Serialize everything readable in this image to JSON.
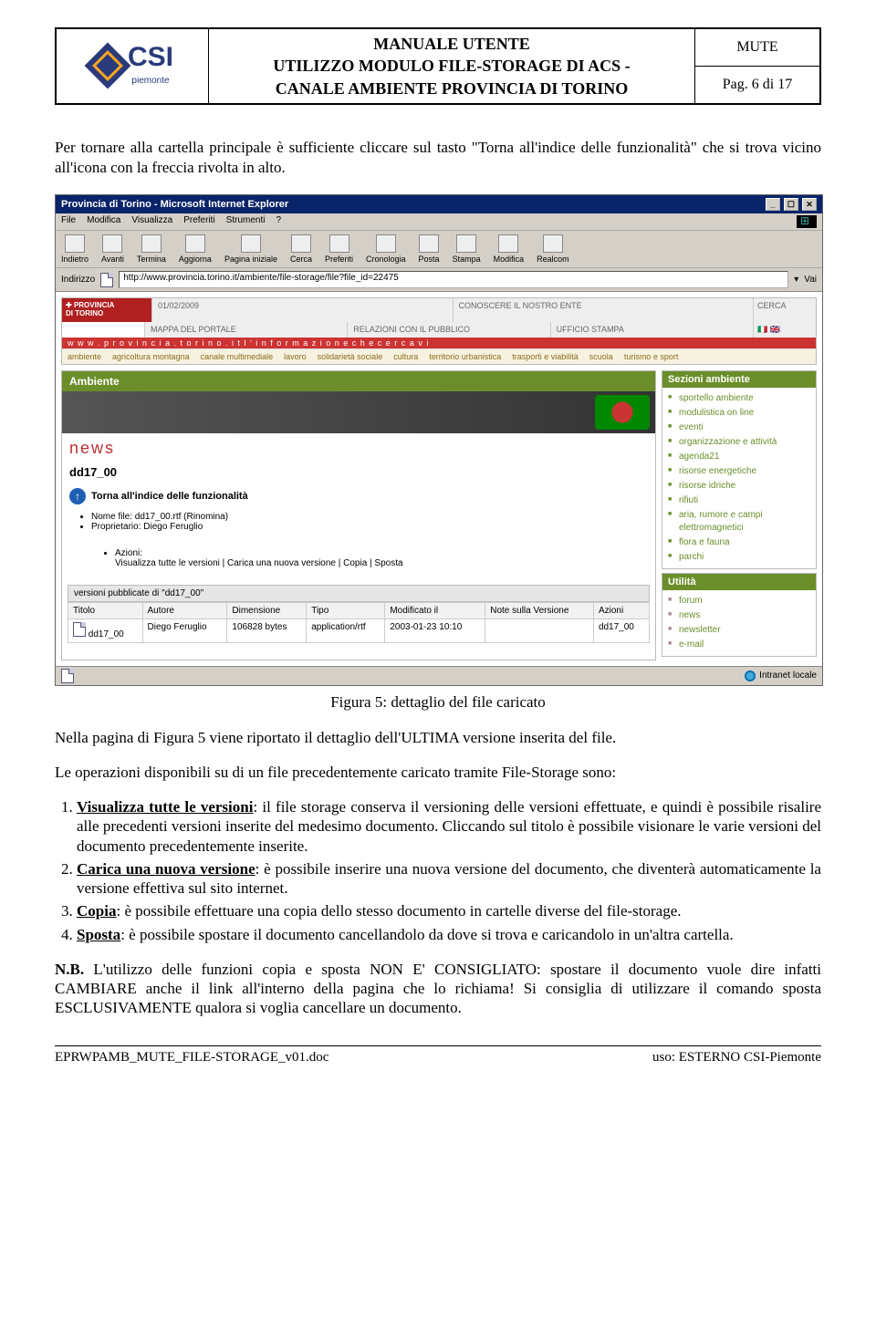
{
  "header": {
    "logo_main": "CSI",
    "logo_sub": "piemonte",
    "title_l1": "MANUALE UTENTE",
    "title_l2": "UTILIZZO MODULO FILE-STORAGE DI ACS -",
    "title_l3": "CANALE AMBIENTE PROVINCIA DI TORINO",
    "right_top": "MUTE",
    "right_bottom": "Pag. 6 di 17"
  },
  "intro": "Per tornare alla cartella principale è sufficiente cliccare sul tasto \"Torna all'indice delle funzionalità\" che si trova vicino all'icona con la freccia rivolta in alto.",
  "screenshot": {
    "title": "Provincia di Torino - Microsoft Internet Explorer",
    "menu": [
      "File",
      "Modifica",
      "Visualizza",
      "Preferiti",
      "Strumenti",
      "?"
    ],
    "toolbar": [
      "Indietro",
      "Avanti",
      "Termina",
      "Aggiorna",
      "Pagina iniziale",
      "Cerca",
      "Preferiti",
      "Cronologia",
      "Posta",
      "Stampa",
      "Modifica",
      "Realcom"
    ],
    "address_label": "Indirizzo",
    "address_url": "http://www.provincia.torino.it/ambiente/file-storage/file?file_id=22475",
    "go_label": "Vai",
    "portal": {
      "logo_l1": "PROVINCIA",
      "logo_l2": "DI TORINO",
      "date": "01/02/2009",
      "top_links1": [
        "CONOSCERE IL NOSTRO ENTE",
        "CERCA"
      ],
      "top_links2": [
        "MAPPA DEL PORTALE",
        "RELAZIONI CON IL PUBBLICO",
        "UFFICIO STAMPA"
      ],
      "tagline": "w w w . p r o v i n c i a . t o r i n o . i t   l ' i n f o r m a z i o n e   c h e   c e r c a v i",
      "nav_links": [
        "ambiente",
        "agricoltura montagna",
        "canale multimediale",
        "lavoro",
        "solidarietà sociale",
        "cultura",
        "territorio urbanistica",
        "trasporti e viabilità",
        "scuola",
        "turismo e sport"
      ],
      "main_title": "Ambiente",
      "news_label": "news",
      "file_code": "dd17_00",
      "torna_label": "Torna all'indice delle funzionalità",
      "meta_name": "Nome file: dd17_00.rtf (Rinomina)",
      "meta_owner": "Proprietario: Diego Feruglio",
      "actions_label": "Azioni:",
      "actions": "Visualizza tutte le versioni | Carica una nuova versione | Copia | Sposta",
      "versions_header": "versioni pubblicate di \"dd17_00\"",
      "table_headers": [
        "Titolo",
        "Autore",
        "Dimensione",
        "Tipo",
        "Modificato il",
        "Note sulla Versione",
        "Azioni"
      ],
      "table_row": {
        "title": "dd17_00",
        "author": "Diego Feruglio",
        "size": "106828 bytes",
        "type": "application/rtf",
        "modified": "2003-01-23 10:10",
        "notes": "",
        "actions": "dd17_00"
      },
      "side_sections_title": "Sezioni ambiente",
      "side_sections": [
        "sportello ambiente",
        "modulistica on line",
        "eventi",
        "organizzazione e attività",
        "agenda21",
        "risorse energetiche",
        "risorse idriche",
        "rifiuti",
        "aria, rumore e campi elettromagnetici",
        "flora e fauna",
        "parchi"
      ],
      "side_util_title": "Utilità",
      "side_util": [
        "forum",
        "news",
        "newsletter",
        "e-mail"
      ]
    },
    "status_right": "Intranet locale"
  },
  "caption": "Figura 5: dettaglio del file caricato",
  "para1": "Nella pagina di Figura 5 viene riportato il dettaglio dell'ULTIMA versione inserita del file.",
  "para2": "Le operazioni disponibili su di un file precedentemente caricato tramite File-Storage sono:",
  "list": {
    "i1_b": "Visualizza tutte le versioni",
    "i1": ": il file storage conserva il versioning delle versioni effettuate, e quindi è possibile risalire alle precedenti versioni inserite del medesimo documento. Cliccando sul titolo è possibile visionare le varie versioni del documento precedentemente inserite.",
    "i2_b": "Carica una nuova versione",
    "i2": ": è possibile inserire una nuova versione del documento, che diventerà automaticamente la versione effettiva sul sito internet.",
    "i3_b": "Copia",
    "i3": ": è possibile effettuare una copia dello stesso documento in cartelle diverse del file-storage.",
    "i4_b": "Sposta",
    "i4": ": è possibile spostare il documento cancellandolo da dove si trova e caricandolo in un'altra cartella."
  },
  "nb_label": "N.B.",
  "nb_text": " L'utilizzo delle funzioni copia e sposta NON E' CONSIGLIATO: spostare il documento vuole dire infatti CAMBIARE anche il link all'interno della pagina che lo richiama! Si consiglia di utilizzare il comando sposta ESCLUSIVAMENTE qualora si voglia cancellare un documento.",
  "footer": {
    "left": "EPRWPAMB_MUTE_FILE-STORAGE_v01.doc",
    "right_label": "uso:",
    "right_value": " ESTERNO CSI-Piemonte"
  }
}
